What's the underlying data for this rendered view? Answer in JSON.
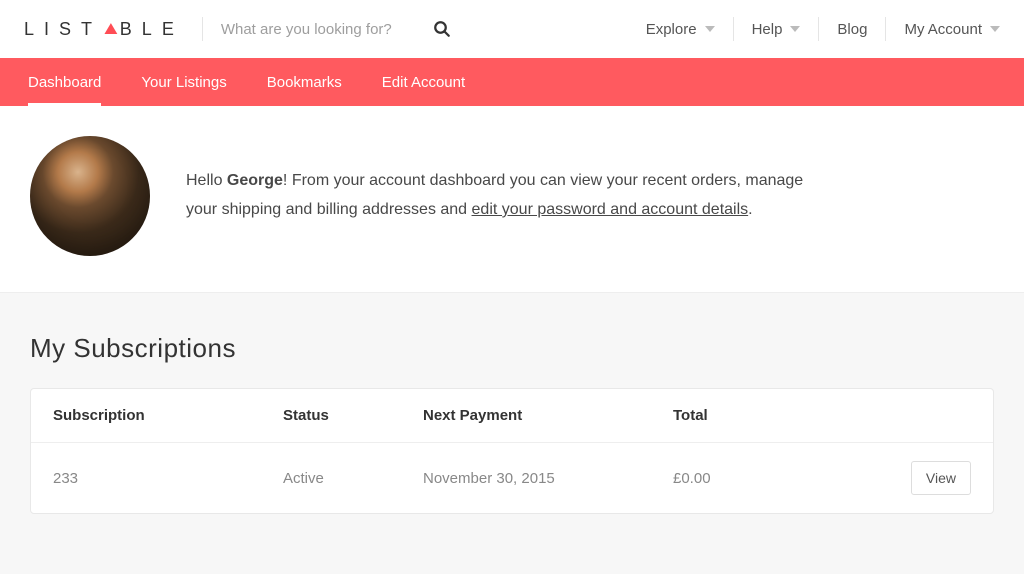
{
  "brand": {
    "pre": "LIST",
    "accent": "▲",
    "post": "BLE"
  },
  "search": {
    "placeholder": "What are you looking for?"
  },
  "topnav": {
    "explore": "Explore",
    "help": "Help",
    "blog": "Blog",
    "account": "My Account"
  },
  "tabs": {
    "dashboard": "Dashboard",
    "listings": "Your Listings",
    "bookmarks": "Bookmarks",
    "edit": "Edit Account"
  },
  "welcome": {
    "hello": "Hello ",
    "name": "George",
    "after_name": "! From your account dashboard you can view your recent orders, manage your shipping and billing addresses and ",
    "link": "edit your password and account details",
    "period": "."
  },
  "subs": {
    "title": "My Subscriptions",
    "head": {
      "c1": "Subscription",
      "c2": "Status",
      "c3": "Next Payment",
      "c4": "Total"
    },
    "row": {
      "c1": "233",
      "c2": "Active",
      "c3": "November 30, 2015",
      "c4": "£0.00",
      "view": "View"
    }
  }
}
